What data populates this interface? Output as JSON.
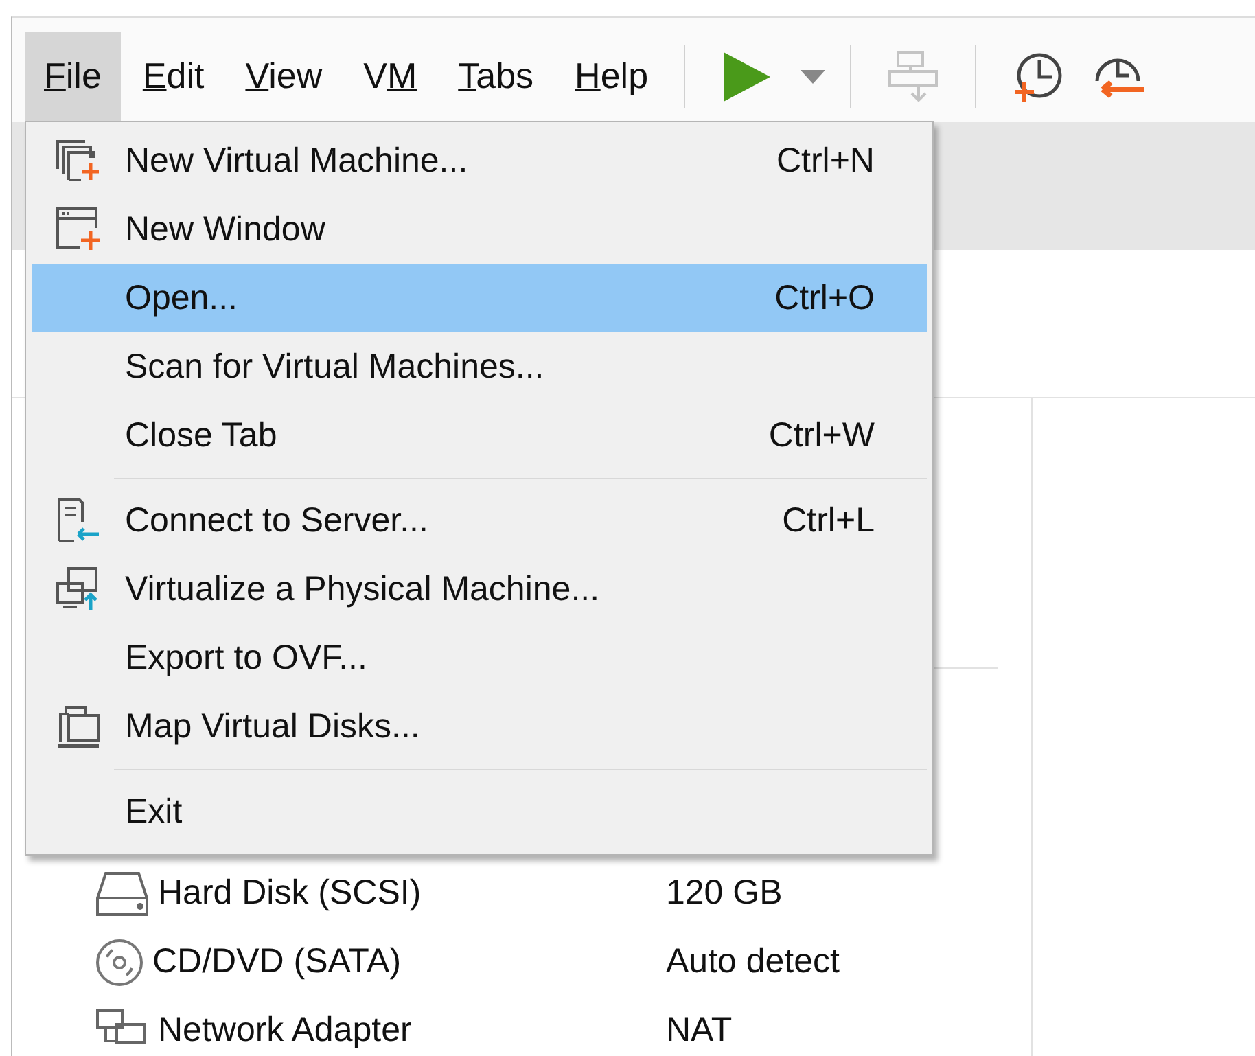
{
  "menu_bar": [
    {
      "key": "F",
      "after": "ile",
      "selected": true
    },
    {
      "key": "E",
      "after": "dit",
      "selected": false
    },
    {
      "key": "V",
      "after": "iew",
      "selected": false
    },
    {
      "before": "V",
      "key": "M",
      "selected": false
    },
    {
      "key": "T",
      "after": "abs",
      "selected": false
    },
    {
      "key": "H",
      "after": "elp",
      "selected": false
    }
  ],
  "toolbar": [
    {
      "kind": "separator"
    },
    {
      "kind": "play",
      "disabled": false
    },
    {
      "kind": "dropdown",
      "disabled": false
    },
    {
      "kind": "separator"
    },
    {
      "kind": "send-keys",
      "disabled": true
    },
    {
      "kind": "separator"
    },
    {
      "kind": "snapshot",
      "disabled": false
    },
    {
      "kind": "revert",
      "disabled": false
    }
  ],
  "file_menu": [
    {
      "kind": "new-vm",
      "label": "New Virtual Machine...",
      "shortcut": "Ctrl+N",
      "selected": false
    },
    {
      "kind": "new-window",
      "label": "New Window",
      "selected": false
    },
    {
      "kind": "plain",
      "label": "Open...",
      "shortcut": "Ctrl+O",
      "selected": true
    },
    {
      "kind": "plain",
      "label": "Scan for Virtual Machines...",
      "selected": false
    },
    {
      "kind": "plain",
      "label": "Close Tab",
      "shortcut": "Ctrl+W",
      "selected": false
    },
    {
      "kind": "separator"
    },
    {
      "kind": "connect",
      "label": "Connect to Server...",
      "shortcut": "Ctrl+L",
      "selected": false
    },
    {
      "kind": "virtualize",
      "label": "Virtualize a Physical Machine...",
      "selected": false
    },
    {
      "kind": "plain",
      "label": "Export to OVF...",
      "selected": false
    },
    {
      "kind": "map-disks",
      "label": "Map Virtual Disks...",
      "selected": false
    },
    {
      "kind": "separator"
    },
    {
      "kind": "plain",
      "label": "Exit",
      "selected": false
    }
  ],
  "hardware": [
    {
      "kind": "disk",
      "name": "Hard Disk (SCSI)",
      "value": "120 GB"
    },
    {
      "kind": "cd",
      "name": "CD/DVD (SATA)",
      "value": "Auto detect"
    },
    {
      "kind": "network",
      "name": "Network Adapter",
      "value": "NAT"
    }
  ]
}
